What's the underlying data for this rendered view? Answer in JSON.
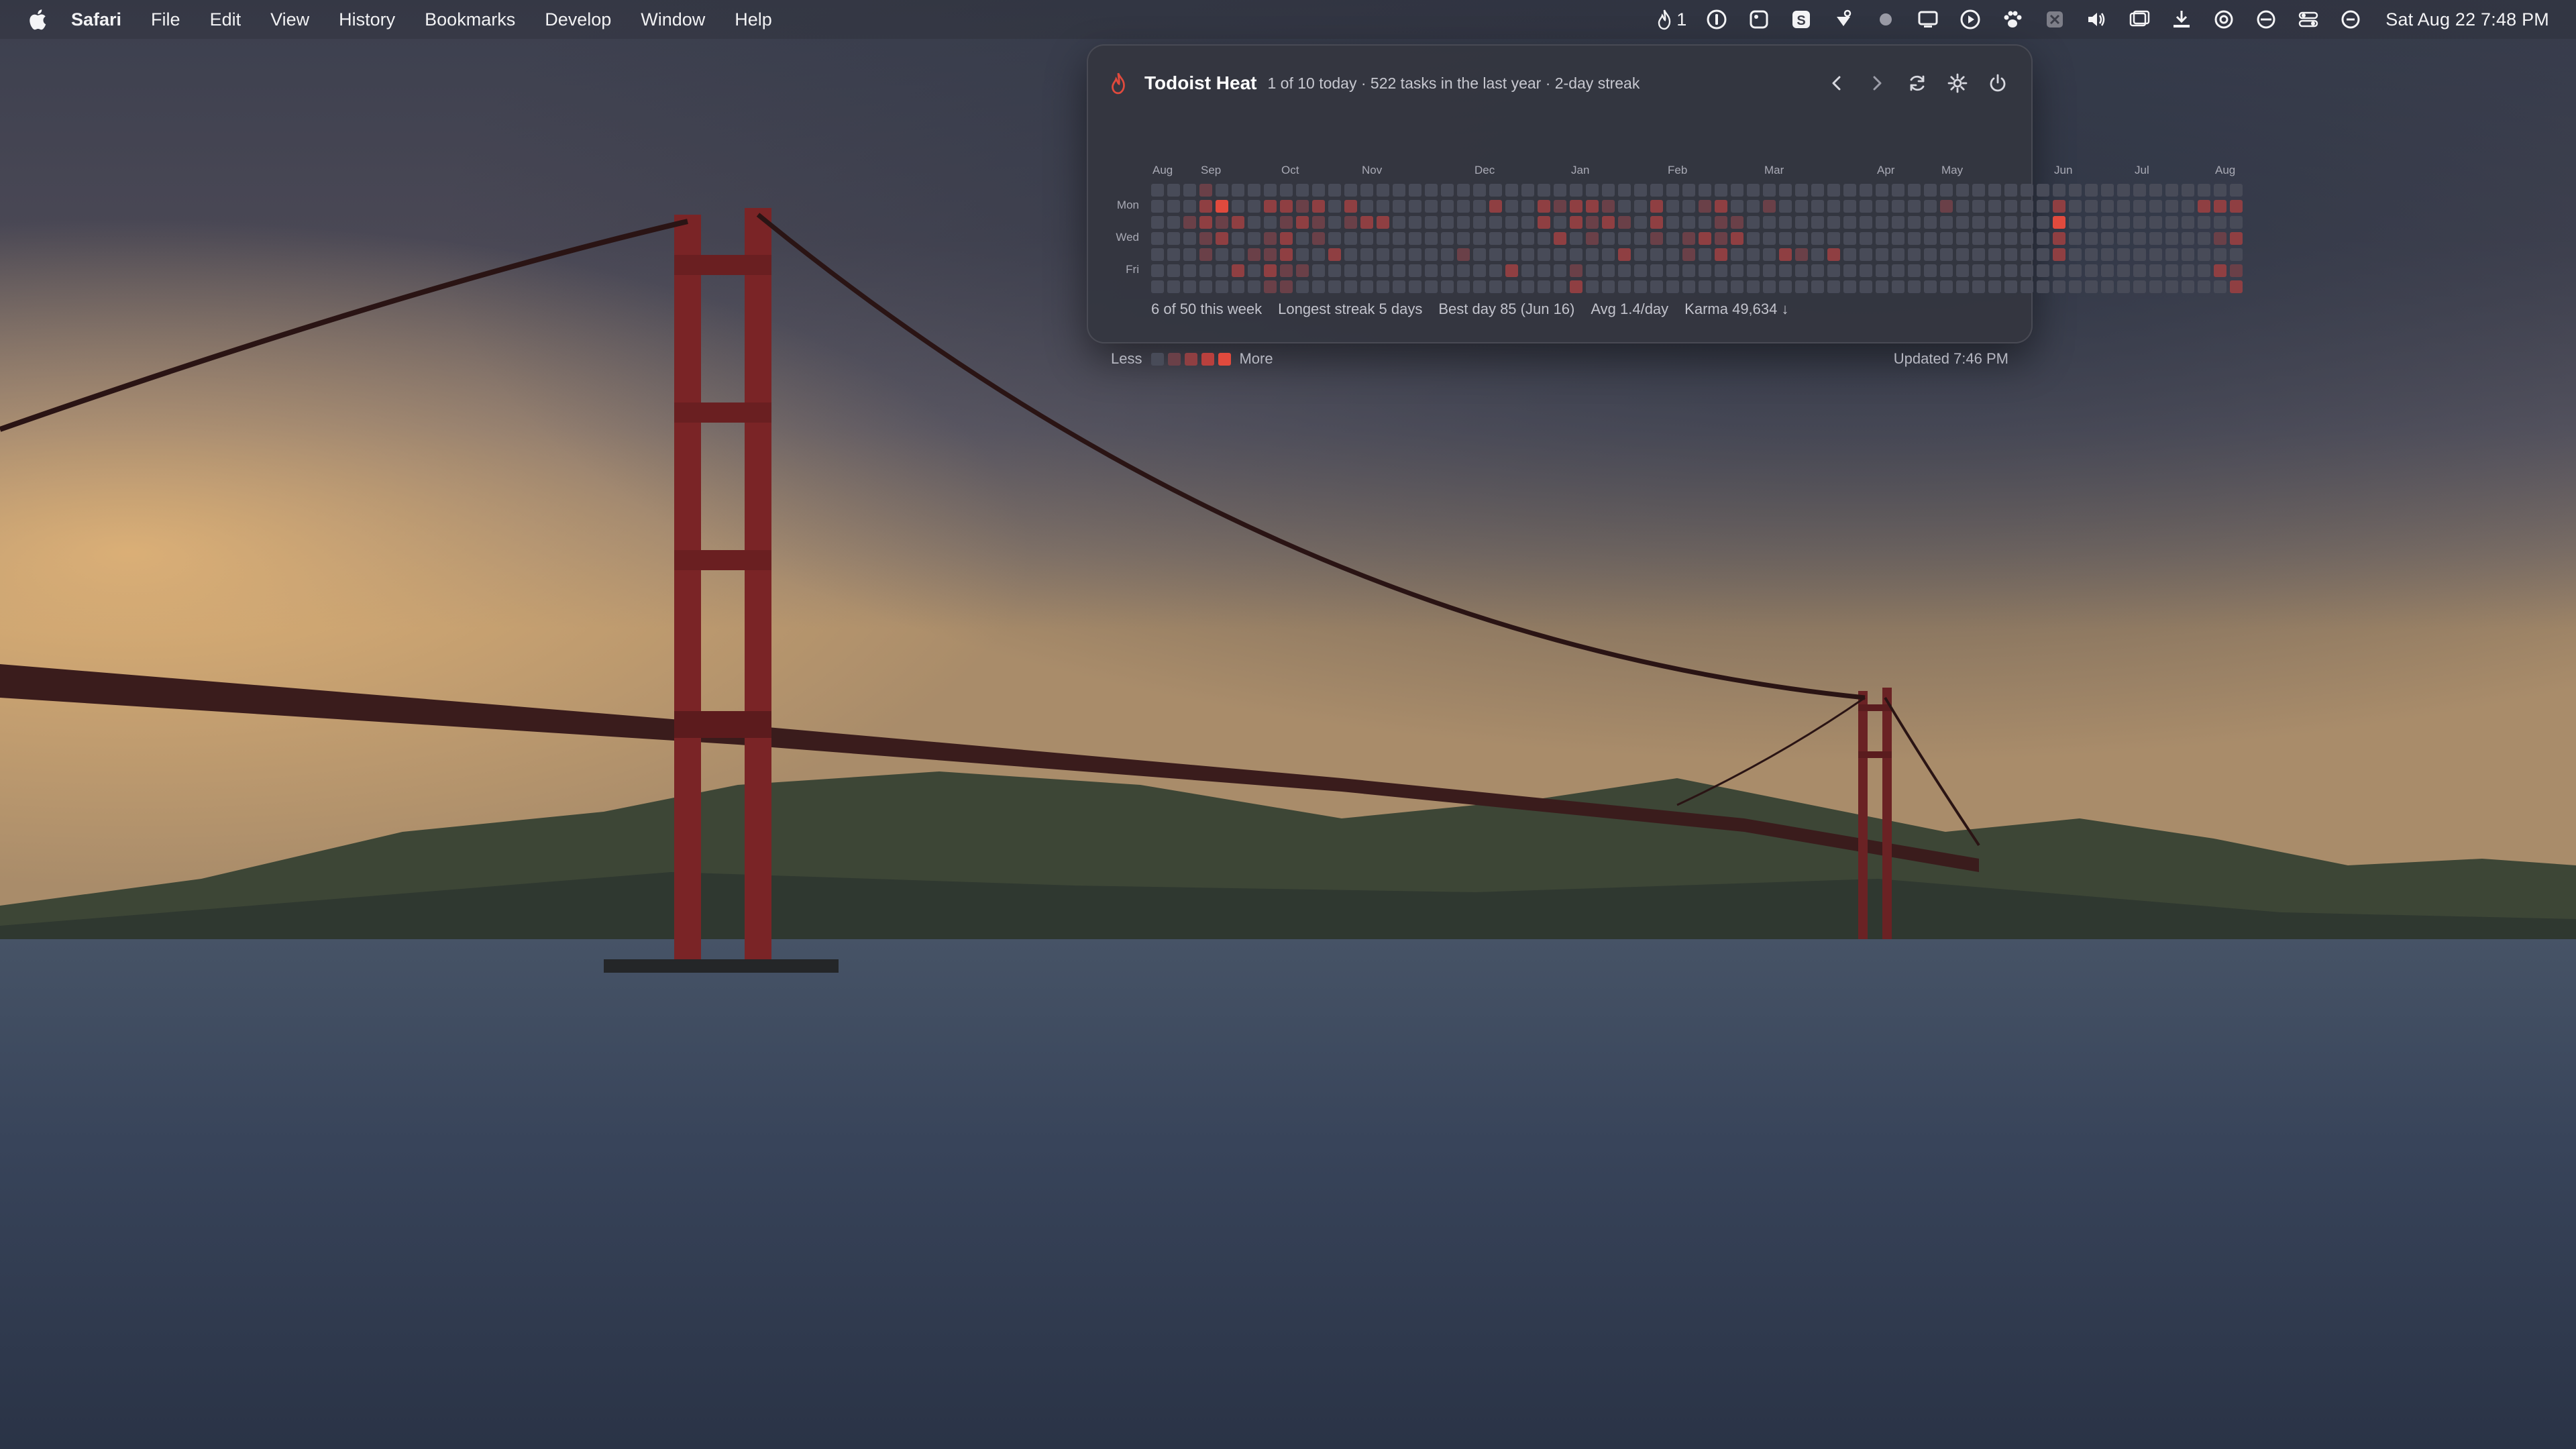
{
  "menubar": {
    "app_name": "Safari",
    "menus": [
      "File",
      "Edit",
      "View",
      "History",
      "Bookmarks",
      "Develop",
      "Window",
      "Help"
    ],
    "flame_count": "1",
    "clock": "Sat Aug 22  7:48 PM",
    "status_icons": [
      "onepassword-icon",
      "screenshot-icon",
      "s-app-icon",
      "heart-satellite-icon",
      "dot-icon",
      "display-icon",
      "play-icon",
      "paw-icon",
      "x-app-icon",
      "volume-icon",
      "window-icon",
      "download-icon",
      "threads-icon",
      "focus-icon",
      "control-center-icon",
      "siri-icon"
    ]
  },
  "popover": {
    "title": "Todoist Heat",
    "summary": "1 of 10 today · 522 tasks in the last year · 2-day streak",
    "months": [
      "Aug",
      "Sep",
      "Oct",
      "Nov",
      "Dec",
      "Jan",
      "Feb",
      "Mar",
      "Apr",
      "May",
      "Jun",
      "Jul",
      "Aug"
    ],
    "day_labels": [
      "Mon",
      "Wed",
      "Fri"
    ],
    "stats": [
      "6 of 50 this week",
      "Longest streak 5 days",
      "Best day 85 (Jun 16)",
      "Avg 1.4/day",
      "Karma 49,634 ↓"
    ],
    "legend_less": "Less",
    "legend_more": "More",
    "updated": "Updated 7:46 PM",
    "colors": {
      "level0": "#484b58",
      "level1": "#6a4048",
      "level2": "#8f3f42",
      "level3": "#b9403d",
      "level4": "#e04a3d"
    },
    "heatmap_levels": [
      [
        0,
        0,
        0,
        0,
        0,
        0,
        0
      ],
      [
        0,
        0,
        0,
        0,
        0,
        0,
        0
      ],
      [
        0,
        0,
        1,
        0,
        0,
        0,
        0
      ],
      [
        1,
        2,
        2,
        1,
        1,
        0,
        0
      ],
      [
        0,
        4,
        1,
        2,
        0,
        0,
        0
      ],
      [
        0,
        0,
        2,
        0,
        0,
        2,
        0
      ],
      [
        0,
        0,
        0,
        0,
        1,
        0,
        0
      ],
      [
        0,
        2,
        0,
        1,
        1,
        2,
        1
      ],
      [
        0,
        2,
        1,
        2,
        2,
        1,
        1
      ],
      [
        0,
        1,
        2,
        0,
        0,
        1,
        0
      ],
      [
        0,
        2,
        1,
        1,
        0,
        0,
        0
      ],
      [
        0,
        0,
        0,
        0,
        2,
        0,
        0
      ],
      [
        0,
        2,
        1,
        0,
        0,
        0,
        0
      ],
      [
        0,
        0,
        2,
        0,
        0,
        0,
        0
      ],
      [
        0,
        0,
        2,
        0,
        0,
        0,
        0
      ],
      [
        0,
        0,
        0,
        0,
        0,
        0,
        0
      ],
      [
        0,
        0,
        0,
        0,
        0,
        0,
        0
      ],
      [
        0,
        0,
        0,
        0,
        0,
        0,
        0
      ],
      [
        0,
        0,
        0,
        0,
        0,
        0,
        0
      ],
      [
        0,
        0,
        0,
        0,
        1,
        0,
        0
      ],
      [
        0,
        0,
        0,
        0,
        0,
        0,
        0
      ],
      [
        0,
        2,
        0,
        0,
        0,
        0,
        0
      ],
      [
        0,
        0,
        0,
        0,
        0,
        2,
        0
      ],
      [
        0,
        0,
        0,
        0,
        0,
        0,
        0
      ],
      [
        0,
        2,
        2,
        0,
        0,
        0,
        0
      ],
      [
        0,
        1,
        0,
        2,
        0,
        0,
        0
      ],
      [
        0,
        2,
        2,
        0,
        0,
        1,
        2
      ],
      [
        0,
        2,
        1,
        1,
        0,
        0,
        0
      ],
      [
        0,
        1,
        2,
        0,
        0,
        0,
        0
      ],
      [
        0,
        0,
        1,
        0,
        2,
        0,
        0
      ],
      [
        0,
        0,
        0,
        0,
        0,
        0,
        0
      ],
      [
        0,
        2,
        2,
        1,
        0,
        0,
        0
      ],
      [
        0,
        0,
        0,
        0,
        0,
        0,
        0
      ],
      [
        0,
        0,
        0,
        1,
        1,
        0,
        0
      ],
      [
        0,
        1,
        0,
        2,
        0,
        0,
        0
      ],
      [
        0,
        2,
        1,
        1,
        2,
        0,
        0
      ],
      [
        0,
        0,
        1,
        2,
        0,
        0,
        0
      ],
      [
        0,
        0,
        0,
        0,
        0,
        0,
        0
      ],
      [
        0,
        1,
        0,
        0,
        0,
        0,
        0
      ],
      [
        0,
        0,
        0,
        0,
        2,
        0,
        0
      ],
      [
        0,
        0,
        0,
        0,
        1,
        0,
        0
      ],
      [
        0,
        0,
        0,
        0,
        0,
        0,
        0
      ],
      [
        0,
        0,
        0,
        0,
        2,
        0,
        0
      ],
      [
        0,
        0,
        0,
        0,
        0,
        0,
        0
      ],
      [
        0,
        0,
        0,
        0,
        0,
        0,
        0
      ],
      [
        0,
        0,
        0,
        0,
        0,
        0,
        0
      ],
      [
        0,
        0,
        0,
        0,
        0,
        0,
        0
      ],
      [
        0,
        0,
        0,
        0,
        0,
        0,
        0
      ],
      [
        0,
        0,
        0,
        0,
        0,
        0,
        0
      ],
      [
        0,
        1,
        0,
        0,
        0,
        0,
        0
      ],
      [
        0,
        0,
        0,
        0,
        0,
        0,
        0
      ],
      [
        0,
        0,
        0,
        0,
        0,
        0,
        0
      ],
      [
        0,
        0,
        0,
        0,
        0,
        0,
        0
      ],
      [
        0,
        0,
        0,
        0,
        0,
        0,
        0
      ],
      [
        0,
        0,
        0,
        0,
        0,
        0,
        0
      ],
      [
        0,
        0,
        0,
        0,
        0,
        0,
        0
      ],
      [
        0,
        2,
        4,
        2,
        2,
        0,
        0
      ],
      [
        0,
        0,
        0,
        0,
        0,
        0,
        0
      ],
      [
        0,
        0,
        0,
        0,
        0,
        0,
        0
      ],
      [
        0,
        0,
        0,
        0,
        0,
        0,
        0
      ],
      [
        0,
        0,
        0,
        0,
        0,
        0,
        0
      ],
      [
        0,
        0,
        0,
        0,
        0,
        0,
        0
      ],
      [
        0,
        0,
        0,
        0,
        0,
        0,
        0
      ],
      [
        0,
        0,
        0,
        0,
        0,
        0,
        0
      ],
      [
        0,
        0,
        0,
        0,
        0,
        0,
        0
      ],
      [
        0,
        2,
        0,
        0,
        0,
        0,
        0
      ],
      [
        0,
        2,
        0,
        1,
        0,
        2,
        0
      ],
      [
        0,
        2,
        0,
        2,
        0,
        1,
        2
      ]
    ]
  }
}
